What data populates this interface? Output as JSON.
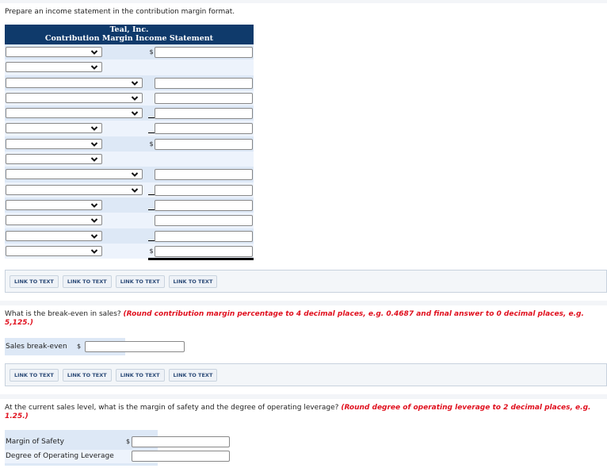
{
  "intro": "Prepare an income statement in the contribution margin format.",
  "statement": {
    "company": "Teal, Inc.",
    "title": "Contribution Margin Income Statement",
    "rows": [
      {
        "select": "short",
        "prefix": "$",
        "input": true,
        "value": ""
      },
      {
        "select": "short",
        "prefix": "",
        "input": false,
        "value": ""
      },
      {
        "select": "long",
        "prefix": "",
        "input": true,
        "value": ""
      },
      {
        "select": "long",
        "prefix": "",
        "input": true,
        "value": ""
      },
      {
        "select": "long",
        "prefix": "_",
        "input": true,
        "value": ""
      },
      {
        "select": "short",
        "prefix": "_",
        "input": true,
        "value": ""
      },
      {
        "select": "short",
        "prefix": "$",
        "input": true,
        "value": ""
      },
      {
        "select": "short",
        "prefix": "",
        "input": false,
        "value": ""
      },
      {
        "select": "long",
        "prefix": "",
        "input": true,
        "value": ""
      },
      {
        "select": "long",
        "prefix": "_",
        "input": true,
        "value": ""
      },
      {
        "select": "short",
        "prefix": "_",
        "input": true,
        "value": ""
      },
      {
        "select": "short",
        "prefix": "",
        "input": true,
        "value": ""
      },
      {
        "select": "short",
        "prefix": "_",
        "input": true,
        "value": ""
      },
      {
        "select": "short",
        "prefix": "$",
        "input": true,
        "value": "",
        "double_underline": true
      }
    ]
  },
  "link_buttons_1": [
    "LINK TO TEXT",
    "LINK TO TEXT",
    "LINK TO TEXT",
    "LINK TO TEXT"
  ],
  "question_breakeven": {
    "text": "What is the break-even in sales? ",
    "hint": "(Round contribution margin percentage to 4 decimal places, e.g. 0.4687 and final answer to 0 decimal places, e.g. 5,125.)",
    "label": "Sales break-even",
    "prefix": "$",
    "value": ""
  },
  "link_buttons_2": [
    "LINK TO TEXT",
    "LINK TO TEXT",
    "LINK TO TEXT",
    "LINK TO TEXT"
  ],
  "question_safety": {
    "text": "At the current sales level, what is the margin of safety and the degree of operating leverage? ",
    "hint": "(Round degree of operating leverage to 2 decimal places, e.g. 1.25.)",
    "rows": [
      {
        "label": "Margin of Safety",
        "prefix": "$",
        "value": ""
      },
      {
        "label": "Degree of Operating Leverage",
        "prefix": "",
        "value": ""
      }
    ]
  },
  "icons": {
    "dropdown": "chevron-down-icon"
  }
}
